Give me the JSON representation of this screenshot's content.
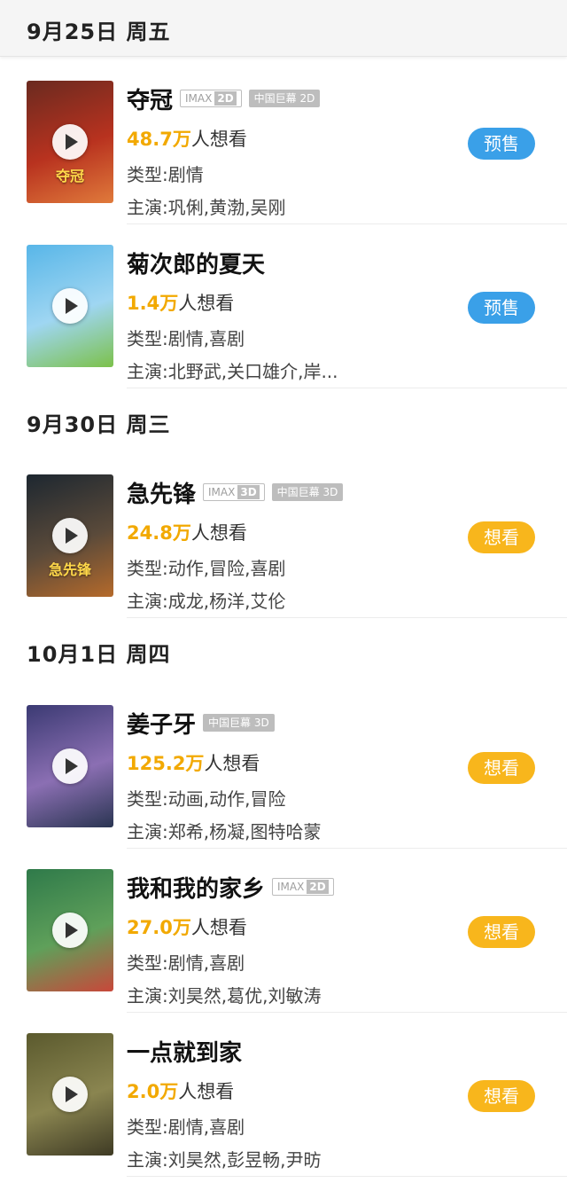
{
  "sticky_date": "9月25日 周五",
  "sections": [
    {
      "date": "9月30日 周三"
    },
    {
      "date": "10月1日 周四"
    }
  ],
  "movies": [
    {
      "title": "夺冠",
      "tags": [
        {
          "type": "imax",
          "label": "IMAX",
          "dim": "2D"
        },
        {
          "type": "china",
          "label": "中国巨幕 2D"
        }
      ],
      "want_num": "48.7万",
      "want_suffix": "人想看",
      "genre": "类型:剧情",
      "cast": "主演:巩俐,黄渤,吴刚",
      "button": "预售",
      "button_type": "presale",
      "poster_text": "夺冠",
      "poster_colors": [
        "#6a2a1f",
        "#b8321f",
        "#e07a3b"
      ]
    },
    {
      "title": "菊次郎的夏天",
      "tags": [],
      "want_num": "1.4万",
      "want_suffix": "人想看",
      "genre": "类型:剧情,喜剧",
      "cast": "主演:北野武,关口雄介,岸...",
      "button": "预售",
      "button_type": "presale",
      "poster_text": "",
      "poster_colors": [
        "#58b6e8",
        "#9fd6f2",
        "#7cc14a"
      ]
    },
    {
      "title": "急先锋",
      "tags": [
        {
          "type": "imax",
          "label": "IMAX",
          "dim": "3D"
        },
        {
          "type": "china",
          "label": "中国巨幕 3D"
        }
      ],
      "want_num": "24.8万",
      "want_suffix": "人想看",
      "genre": "类型:动作,冒险,喜剧",
      "cast": "主演:成龙,杨洋,艾伦",
      "button": "想看",
      "button_type": "want",
      "poster_text": "急先锋",
      "poster_colors": [
        "#1d2730",
        "#5a4a3a",
        "#b56a2b"
      ]
    },
    {
      "title": "姜子牙",
      "tags": [
        {
          "type": "china",
          "label": "中国巨幕 3D"
        }
      ],
      "want_num": "125.2万",
      "want_suffix": "人想看",
      "genre": "类型:动画,动作,冒险",
      "cast": "主演:郑希,杨凝,图特哈蒙",
      "button": "想看",
      "button_type": "want",
      "poster_text": "",
      "poster_colors": [
        "#3b3a73",
        "#8b6fb3",
        "#2a3552"
      ]
    },
    {
      "title": "我和我的家乡",
      "tags": [
        {
          "type": "imax",
          "label": "IMAX",
          "dim": "2D"
        }
      ],
      "want_num": "27.0万",
      "want_suffix": "人想看",
      "genre": "类型:剧情,喜剧",
      "cast": "主演:刘昊然,葛优,刘敏涛",
      "button": "想看",
      "button_type": "want",
      "poster_text": "",
      "poster_colors": [
        "#2f7a4a",
        "#5fa05a",
        "#c9473a"
      ]
    },
    {
      "title": "一点就到家",
      "tags": [],
      "want_num": "2.0万",
      "want_suffix": "人想看",
      "genre": "类型:剧情,喜剧",
      "cast": "主演:刘昊然,彭昱畅,尹昉",
      "button": "想看",
      "button_type": "want",
      "poster_text": "",
      "poster_colors": [
        "#5b5a2e",
        "#8a8550",
        "#3e3a24"
      ]
    }
  ]
}
